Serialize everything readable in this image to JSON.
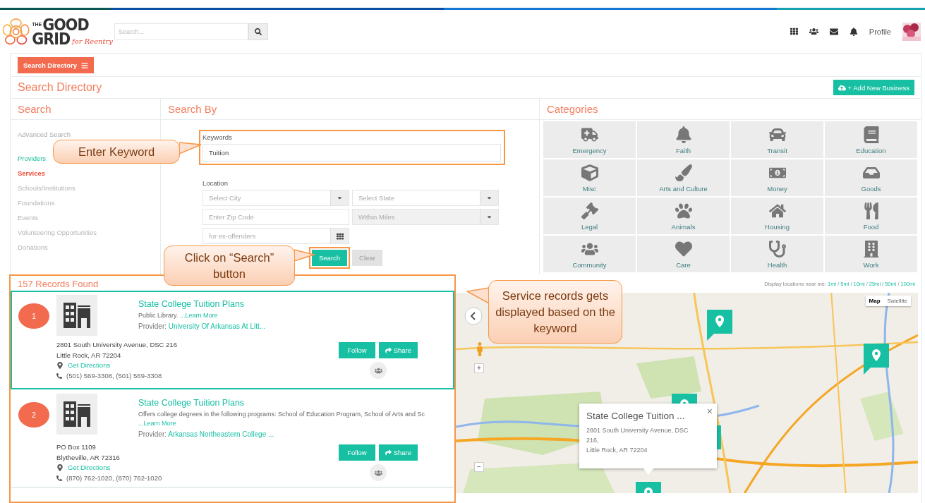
{
  "header": {
    "logo": {
      "top": "THE",
      "word1": "GOOD",
      "word2": "GRID",
      "tagline": "for Reentry"
    },
    "search": {
      "placeholder": "Search..."
    },
    "profile_label": "Profile"
  },
  "toolbar": {
    "directory_button": "Search Directory"
  },
  "page_title": "Search Directory",
  "add_button": "+ Add New Business",
  "search_panel": {
    "title": "Search",
    "advanced": "Advanced Search",
    "items": [
      {
        "label": "Providers",
        "selected": false,
        "disabled": false
      },
      {
        "label": "Services",
        "selected": true,
        "disabled": false
      },
      {
        "label": "Schools/Institutions",
        "selected": false,
        "disabled": true
      },
      {
        "label": "Foundations",
        "selected": false,
        "disabled": true
      },
      {
        "label": "Events",
        "selected": false,
        "disabled": true
      },
      {
        "label": "Volunteering Opportunities",
        "selected": false,
        "disabled": true
      },
      {
        "label": "Donations",
        "selected": false,
        "disabled": true
      }
    ]
  },
  "search_by": {
    "title": "Search By",
    "keywords": {
      "label": "Keywords",
      "value": "Tuition",
      "highlighted": true
    },
    "location_label": "Location",
    "fields": [
      {
        "kind": "select",
        "placeholder": "Select City",
        "disabled": false
      },
      {
        "kind": "select",
        "placeholder": "Select State",
        "disabled": false
      },
      {
        "kind": "input",
        "placeholder": "Enter Zip Code",
        "disabled": false
      },
      {
        "kind": "select",
        "placeholder": "Within Miles",
        "disabled": true
      },
      {
        "kind": "picker",
        "placeholder": "for ex-offenders",
        "disabled": false
      }
    ],
    "search_button": {
      "label": "Search",
      "highlighted": true
    },
    "clear_button": "Clear"
  },
  "categories": {
    "title": "Categories",
    "items": [
      "Emergency",
      "Faith",
      "Transit",
      "Education",
      "Misc",
      "Arts and Culture",
      "Money",
      "Goods",
      "Legal",
      "Animals",
      "Housing",
      "Food",
      "Community",
      "Care",
      "Health",
      "Work"
    ]
  },
  "results": {
    "count": "157 Records Found",
    "highlighted": true,
    "records": [
      {
        "number": "1",
        "selected": true,
        "title": "State College Tuition Plans",
        "description": "Public Library.",
        "learn_more": "...Learn More",
        "provider_label": "Provider:",
        "provider": "University Of Arkansas At Litt...",
        "address": [
          "2801 South University Avenue, DSC 216",
          "Little Rock, AR 72204"
        ],
        "directions": "Get Directions",
        "phone": "(501) 569-3308, (501) 569-3308",
        "follow": "Follow",
        "share": "Share"
      },
      {
        "number": "2",
        "selected": false,
        "title": "State College Tuition Plans",
        "description": "Offers college degrees in the following programs: School of Education Program, School of Arts and Sc",
        "learn_more": "...Learn More",
        "provider_label": "Provider:",
        "provider": "Arkansas Northeastern College ...",
        "address": [
          "PO Box 1109",
          "Blytheville, AR 72316"
        ],
        "directions": "Get Directions",
        "phone": "(870) 762-1020, (870) 762-1020",
        "follow": "Follow",
        "share": "Share"
      }
    ]
  },
  "map": {
    "near_label": "Display locations near me:",
    "separator": "/",
    "distances": [
      "1mi",
      "5mi",
      "10mi",
      "25mi",
      "50mi",
      "100mi"
    ],
    "map_types": [
      {
        "label": "Map",
        "selected": true
      },
      {
        "label": "Satellite",
        "selected": false
      }
    ],
    "zoom_in": "+",
    "zoom_out": "−",
    "popup": {
      "title": "State College Tuition ...",
      "lines": [
        "2801 South University Avenue, DSC",
        "216,",
        "Little Rock, AR 72204"
      ],
      "close": "×"
    }
  },
  "callouts": [
    {
      "text": "Enter Keyword"
    },
    {
      "text": "Click on “Search” button"
    },
    {
      "text": "Service records gets displayed based on the keyword"
    }
  ]
}
